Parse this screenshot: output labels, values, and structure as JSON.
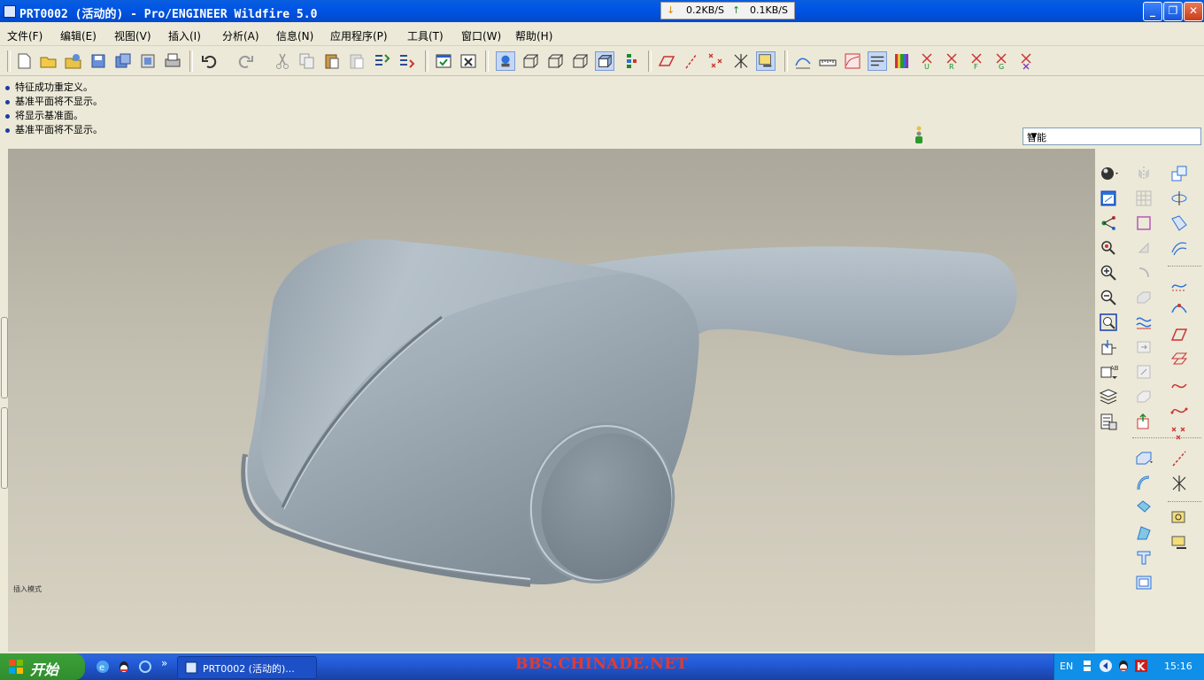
{
  "window": {
    "title": "PRT0002 (活动的) - Pro/ENGINEER Wildfire 5.0",
    "net_down": "0.2KB/S",
    "net_up": "0.1KB/S"
  },
  "menu": {
    "items": [
      "文件(F)",
      "编辑(E)",
      "视图(V)",
      "插入(I)",
      "分析(A)",
      "信息(N)",
      "应用程序(P)",
      "工具(T)",
      "窗口(W)",
      "帮助(H)"
    ]
  },
  "messages": [
    "特征成功重定义。",
    "基准平面将不显示。",
    "将显示基准面。",
    "基准平面将不显示。"
  ],
  "filter": {
    "value": "智能"
  },
  "viewport": {
    "mode_label": "插入模式"
  },
  "taskbar": {
    "start_label": "开始",
    "task_label": "PRT0002 (活动的)...",
    "watermark": "BBS.CHINADE.NET",
    "lang": "EN",
    "clock": "15:16"
  },
  "colors": {
    "titlebar": "#0055e5",
    "viewport_top": "#aba89b",
    "viewport_bottom": "#d8d3c3",
    "model": "#9ba7b1",
    "watermark": "#e63a2e"
  }
}
